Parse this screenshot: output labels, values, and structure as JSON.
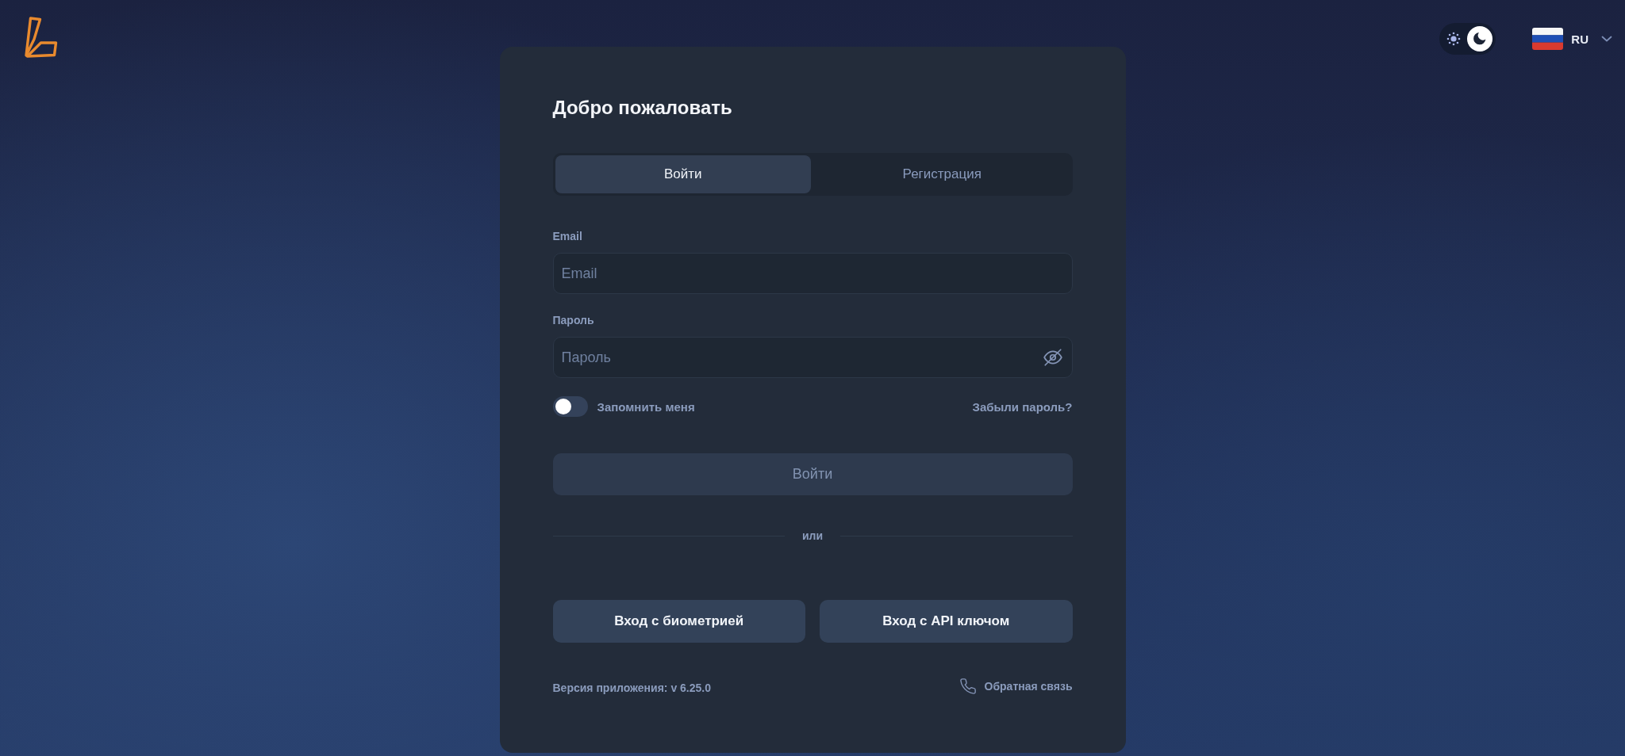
{
  "theme_options": [
    {
      "kind": "light",
      "selected": false
    },
    {
      "kind": "dark",
      "selected": true
    }
  ],
  "language": {
    "code": "RU"
  },
  "card": {
    "title": "Добро пожаловать",
    "tabs": [
      {
        "label": "Войти",
        "selected": true
      },
      {
        "label": "Регистрация",
        "selected": false
      }
    ],
    "fields": [
      {
        "kind": "email",
        "label": "Email",
        "placeholder": "Email"
      },
      {
        "kind": "password",
        "label": "Пароль",
        "placeholder": "Пароль"
      }
    ],
    "remember": {
      "label": "Запомнить меня",
      "on": false
    },
    "forgot_password": "Забыли пароль?",
    "submit": {
      "label": "Войти",
      "disabled": true
    },
    "divider": "или",
    "alt_buttons": [
      "Вход с биометрией",
      "Вход с API ключом"
    ],
    "version": "Версия приложения: v 6.25.0",
    "feedback": "Обратная связь"
  }
}
